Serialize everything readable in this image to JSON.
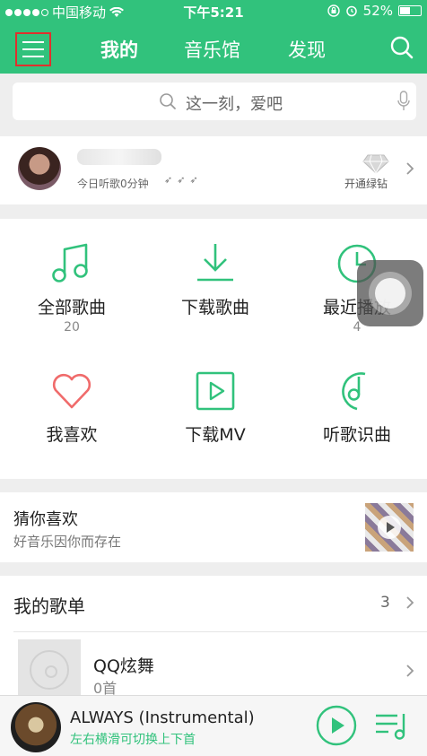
{
  "status_bar": {
    "carrier": "中国移动",
    "time": "下午5:21",
    "battery": "52%",
    "battery_level": 0.52
  },
  "header": {
    "tabs": [
      {
        "label": "我的",
        "active": true
      },
      {
        "label": "音乐馆",
        "active": false
      },
      {
        "label": "发现",
        "active": false
      }
    ],
    "menu_icon": "hamburger-icon",
    "search_icon": "search-icon"
  },
  "search": {
    "placeholder": "这一刻，爱吧"
  },
  "user": {
    "listen_time": "今日听歌0分钟",
    "vip_label": "开通绿钻"
  },
  "shortcuts": [
    {
      "label": "全部歌曲",
      "count": "20",
      "icon": "music-note-icon"
    },
    {
      "label": "下载歌曲",
      "count": "",
      "icon": "download-icon"
    },
    {
      "label": "最近播放",
      "count": "4",
      "icon": "clock-icon"
    },
    {
      "label": "我喜欢",
      "count": "",
      "icon": "heart-icon"
    },
    {
      "label": "下载MV",
      "count": "",
      "icon": "mv-play-icon"
    },
    {
      "label": "听歌识曲",
      "count": "",
      "icon": "recognize-icon"
    }
  ],
  "guess": {
    "title": "猜你喜欢",
    "subtitle": "好音乐因你而存在"
  },
  "playlists": {
    "title": "我的歌单",
    "count": "3",
    "items": [
      {
        "name": "QQ炫舞",
        "songs": "0首"
      }
    ]
  },
  "player": {
    "title": "ALWAYS (Instrumental)",
    "hint": "左右横滑可切换上下首"
  },
  "colors": {
    "brand": "#31c27c",
    "highlight": "#e0302d",
    "heart": "#f06b6b"
  }
}
